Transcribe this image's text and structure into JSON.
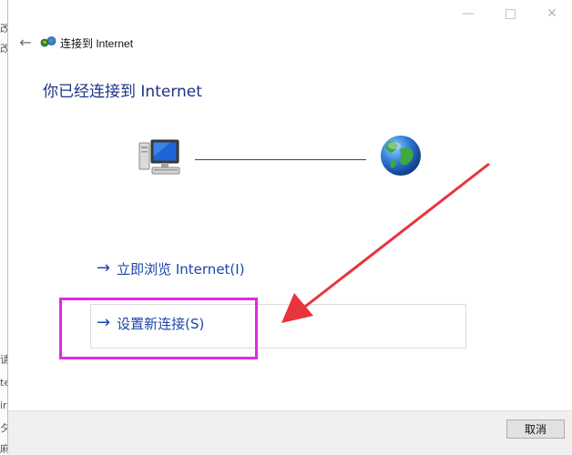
{
  "background_strip": [
    "改",
    "改",
    "请",
    "te",
    "ir",
    "夕",
    "麻组"
  ],
  "wizard": {
    "title": "连接到 Internet",
    "heading": "你已经连接到 Internet",
    "links": [
      {
        "label": "立即浏览 Internet(I)"
      },
      {
        "label": "设置新连接(S)"
      }
    ],
    "cancel_label": "取消"
  },
  "window_controls": {
    "minimize": "—",
    "close": "✕"
  },
  "icons": {
    "back": "←",
    "link_arrow": "→"
  },
  "colors": {
    "link": "#1c46a8",
    "heading": "#1e3287",
    "highlight_box": "#e02ce0",
    "annotation_arrow": "#e8343c"
  }
}
